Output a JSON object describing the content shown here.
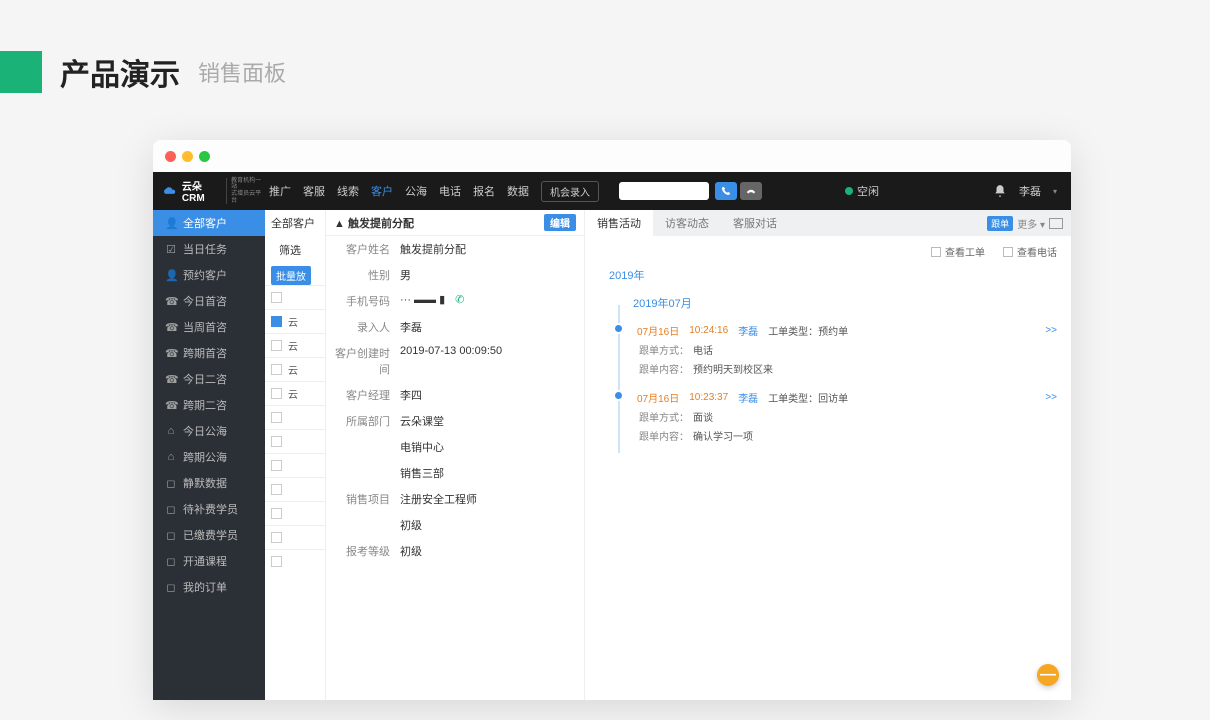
{
  "page_header": {
    "title": "产品演示",
    "subtitle": "销售面板"
  },
  "topnav": {
    "logo_text": "云朵CRM",
    "logo_sub1": "教育机构一站",
    "logo_sub2": "式增员云平台",
    "items": [
      "推广",
      "客服",
      "线索",
      "客户",
      "公海",
      "电话",
      "报名",
      "数据"
    ],
    "active_index": 3,
    "opportunity": "机会录入",
    "status": "空闲",
    "user": "李磊"
  },
  "sidebar": {
    "items": [
      {
        "icon": "👤",
        "label": "全部客户"
      },
      {
        "icon": "☑",
        "label": "当日任务"
      },
      {
        "icon": "👤",
        "label": "预约客户"
      },
      {
        "icon": "☎",
        "label": "今日首咨"
      },
      {
        "icon": "☎",
        "label": "当周首咨"
      },
      {
        "icon": "☎",
        "label": "跨期首咨"
      },
      {
        "icon": "☎",
        "label": "今日二咨"
      },
      {
        "icon": "☎",
        "label": "跨期二咨"
      },
      {
        "icon": "⌂",
        "label": "今日公海"
      },
      {
        "icon": "⌂",
        "label": "跨期公海"
      },
      {
        "icon": "◻",
        "label": "静默数据"
      },
      {
        "icon": "◻",
        "label": "待补费学员"
      },
      {
        "icon": "◻",
        "label": "已缴费学员"
      },
      {
        "icon": "◻",
        "label": "开通课程"
      },
      {
        "icon": "◻",
        "label": "我的订单"
      }
    ],
    "active_index": 0
  },
  "list": {
    "header": "全部客户",
    "filter": "筛选",
    "bulk_chip": "批量放",
    "rows": [
      "",
      "云",
      "云",
      "云",
      "云",
      "",
      "",
      "",
      "",
      "",
      "",
      ""
    ]
  },
  "detail": {
    "title": "触发提前分配",
    "edit": "编辑",
    "fields": [
      {
        "k": "客户姓名",
        "v": "触发提前分配"
      },
      {
        "k": "性别",
        "v": "男"
      },
      {
        "k": "手机号码",
        "v": "···  ▬▬  ▮",
        "phone": true
      },
      {
        "k": "录入人",
        "v": "李磊"
      },
      {
        "k": "客户创建时间",
        "v": "2019-07-13 00:09:50"
      },
      {
        "k": "客户经理",
        "v": "李四"
      },
      {
        "k": "所属部门",
        "v": "云朵课堂"
      },
      {
        "k": "",
        "v": "电销中心"
      },
      {
        "k": "",
        "v": "销售三部"
      },
      {
        "k": "销售项目",
        "v": "注册安全工程师"
      },
      {
        "k": "",
        "v": "初级"
      },
      {
        "k": "报考等级",
        "v": "初级"
      }
    ]
  },
  "activity": {
    "tabs": [
      "销售活动",
      "访客动态",
      "客服对话"
    ],
    "active_tab": 0,
    "follow_pill": "跟单",
    "more": "更多",
    "check1": "查看工单",
    "check2": "查看电话",
    "year": "2019年",
    "month": "2019年07月",
    "items": [
      {
        "date": "07月16日",
        "time": "10:24:16",
        "user": "李磊",
        "type_label": "工单类型：",
        "type_value": "预约单",
        "more": ">>",
        "rows": [
          {
            "k": "跟单方式：",
            "v": "电话"
          },
          {
            "k": "跟单内容：",
            "v": "预约明天到校区来"
          }
        ]
      },
      {
        "date": "07月16日",
        "time": "10:23:37",
        "user": "李磊",
        "type_label": "工单类型：",
        "type_value": "回访单",
        "more": ">>",
        "rows": [
          {
            "k": "跟单方式：",
            "v": "面谈"
          },
          {
            "k": "跟单内容：",
            "v": "确认学习一项"
          }
        ]
      }
    ]
  }
}
